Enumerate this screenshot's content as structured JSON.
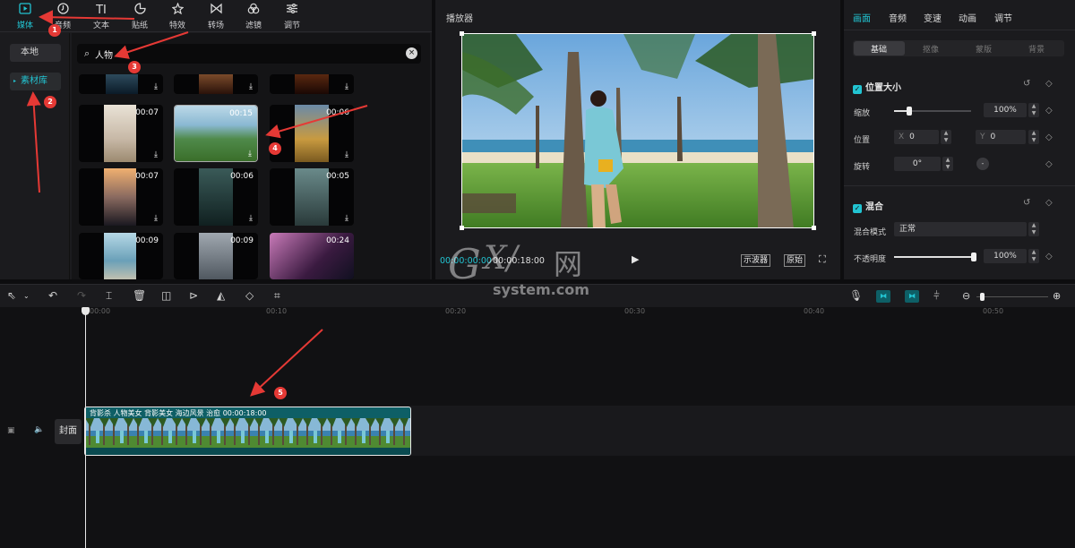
{
  "top_tabs": [
    {
      "label": "媒体",
      "icon": "media-icon"
    },
    {
      "label": "音频",
      "icon": "audio-icon"
    },
    {
      "label": "文本",
      "icon": "text-icon"
    },
    {
      "label": "贴纸",
      "icon": "sticker-icon"
    },
    {
      "label": "特效",
      "icon": "effects-icon"
    },
    {
      "label": "转场",
      "icon": "transition-icon"
    },
    {
      "label": "滤镜",
      "icon": "filter-icon"
    },
    {
      "label": "调节",
      "icon": "adjust-icon"
    }
  ],
  "text_tab_glyph": "TI",
  "side_nav": {
    "local": "本地",
    "library": "素材库"
  },
  "search": {
    "value": "人物"
  },
  "thumbs": [
    {
      "duration": "00:07",
      "download": "⤓"
    },
    {
      "duration": "00:15",
      "download": "⤓"
    },
    {
      "duration": "00:06",
      "download": "⤓"
    },
    {
      "duration": "00:07",
      "download": "⤓"
    },
    {
      "duration": "00:06",
      "download": "⤓"
    },
    {
      "duration": "00:05",
      "download": "⤓"
    },
    {
      "duration": "00:09",
      "download": "⤓"
    },
    {
      "duration": "00:09",
      "download": "⤓"
    },
    {
      "duration": "00:24",
      "download": "⤓"
    }
  ],
  "player": {
    "title": "播放器",
    "current_time": "00:00:00:00",
    "total_time": "00:00:18:00",
    "scope_btn": "示波器",
    "original_btn": "原始"
  },
  "props": {
    "tabs": [
      "画面",
      "音频",
      "变速",
      "动画",
      "调节"
    ],
    "sub_tabs": [
      "基础",
      "抠像",
      "蒙版",
      "背景"
    ],
    "section_size": "位置大小",
    "scale_label": "缩放",
    "scale_value": "100%",
    "scale_level": 0.2,
    "position_label": "位置",
    "pos_x_prefix": "X",
    "pos_x": "0",
    "pos_y_prefix": "Y",
    "pos_y": "0",
    "rotate_label": "旋转",
    "rotate_value": "0°",
    "section_blend": "混合",
    "blend_mode_label": "混合模式",
    "blend_mode_value": "正常",
    "opacity_label": "不透明度",
    "opacity_value": "100%",
    "opacity_level": 1.0
  },
  "ruler": [
    "00:00",
    "00:10",
    "00:20",
    "00:30",
    "00:40",
    "00:50"
  ],
  "track": {
    "cover_label": "封面",
    "clip_label": "背影杀 人物美女  背影美女 海边风景 治愈    00:00:18:00"
  },
  "annotations": [
    "1",
    "2",
    "3",
    "4",
    "5"
  ],
  "watermark": {
    "g": "G",
    "xi": "X/",
    "wang": "网",
    "sub": "system.com"
  },
  "colors": {
    "accent": "#22c4d2",
    "annotation": "#e53935",
    "clip": "#0e5f66"
  }
}
